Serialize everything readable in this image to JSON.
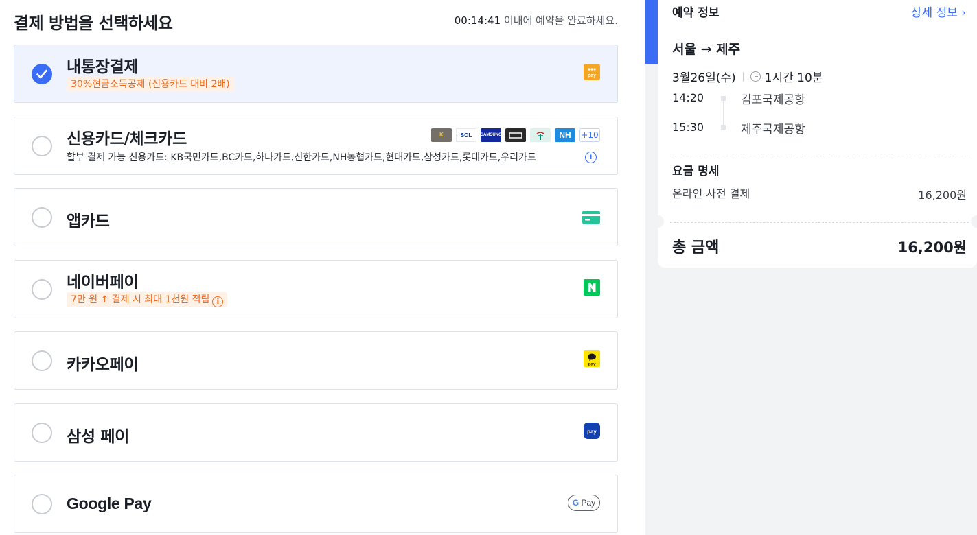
{
  "header": {
    "title": "결제 방법을 선택하세요",
    "timer": "00:14:41",
    "timer_suffix": " 이내에 예약을 완료하세요."
  },
  "payment_methods": [
    {
      "title": "내통장결제",
      "tag": "30%현금소득공제 (신용카드 대비 2배)",
      "selected": true,
      "logo": "toss-bank-pay-icon",
      "logo_text": "pay"
    },
    {
      "title": "신용카드/체크카드",
      "subtext": "할부 결제 가능 신용카드: KB국민카드,BC카드,하나카드,신한카드,NH농협카드,현대카드,삼성카드,롯데카드,우리카드",
      "selected": false,
      "card_logos": [
        {
          "name": "kb-card-icon",
          "label": "K",
          "color": "#746f68"
        },
        {
          "name": "shinhan-sol-pay-icon",
          "label": "SOL",
          "color": "#ffffff"
        },
        {
          "name": "samsung-card-icon",
          "label": "SAMSUNG",
          "color": "#1428a0"
        },
        {
          "name": "hyundai-card-icon",
          "label": "",
          "color": "#2a2a2a"
        },
        {
          "name": "hana-card-icon",
          "label": "",
          "color": "#e0f2ee"
        },
        {
          "name": "nh-card-icon",
          "label": "NH",
          "color": "#1d8ce0"
        }
      ],
      "more_count": "+10"
    },
    {
      "title": "앱카드",
      "selected": false,
      "logo": "app-card-icon"
    },
    {
      "title": "네이버페이",
      "tag": "7만 원 ↑ 결제 시 최대 1천원 적립",
      "selected": false,
      "logo": "naver-pay-icon",
      "logo_text": "N"
    },
    {
      "title": "카카오페이",
      "selected": false,
      "logo": "kakao-pay-icon",
      "logo_text": "pay"
    },
    {
      "title": "삼성 페이",
      "selected": false,
      "logo": "samsung-pay-icon",
      "logo_text": "pay"
    },
    {
      "title": "Google Pay",
      "selected": false,
      "logo": "google-pay-icon",
      "logo_text": "Pay"
    }
  ],
  "summary": {
    "title": "예약 정보",
    "detail_link": "상세 정보",
    "route": "서울 → 제주",
    "date": "3월26일(수)",
    "duration": "1시간 10분",
    "departure_time": "14:20",
    "departure_airport": "김포국제공항",
    "arrival_time": "15:30",
    "arrival_airport": "제주국제공항",
    "fee_title": "요금 명세",
    "fee_name": "온라인 사전 결제",
    "fee_amount": "16,200원",
    "total_label": "총 금액",
    "total_amount": "16,200원"
  },
  "colors": {
    "accent": "#3b6cf6",
    "tag_orange": "#f06a1e",
    "naver_green": "#03c75a",
    "kakao_yellow": "#fee500",
    "toss_orange": "#f5a623"
  }
}
